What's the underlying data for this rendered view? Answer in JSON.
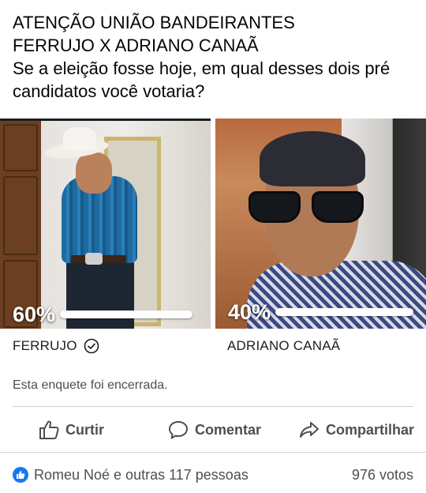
{
  "post": {
    "line1": "ATENÇÃO UNIÃO BANDEIRANTES",
    "line2": "FERRUJO X ADRIANO CANAÃ",
    "line3": "Se a eleição fosse hoje, em qual desses dois pré",
    "line4": "candidatos você votaria?"
  },
  "poll": {
    "options": [
      {
        "name": "FERRUJO",
        "percent_label": "60%",
        "fraction": 0.6,
        "selected": true
      },
      {
        "name": "ADRIANO CANAÃ",
        "percent_label": "40%",
        "fraction": 0.4,
        "selected": false
      }
    ],
    "status": "Esta enquete foi encerrada."
  },
  "actions": {
    "like": "Curtir",
    "comment": "Comentar",
    "share": "Compartilhar"
  },
  "footer": {
    "reactions_text": "Romeu Noé e outras 117 pessoas",
    "votes_text": "976 votos"
  },
  "colors": {
    "accent": "#1877f2",
    "text_secondary": "#4b4f56"
  }
}
